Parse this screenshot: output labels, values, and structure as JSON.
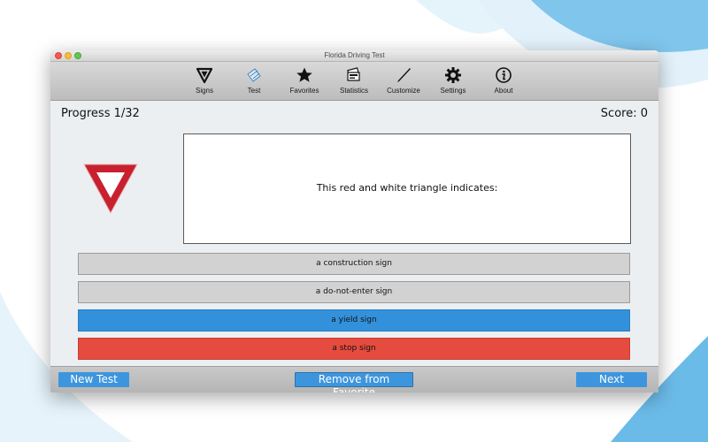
{
  "window": {
    "title": "Florida Driving Test"
  },
  "toolbar": {
    "items": [
      {
        "label": "Signs",
        "icon": "yield-sign-icon"
      },
      {
        "label": "Test",
        "icon": "pencil-paper-icon"
      },
      {
        "label": "Favorites",
        "icon": "star-icon"
      },
      {
        "label": "Statistics",
        "icon": "bank-card-icon"
      },
      {
        "label": "Customize",
        "icon": "pen-nib-icon"
      },
      {
        "label": "Settings",
        "icon": "gear-icon"
      },
      {
        "label": "About",
        "icon": "info-icon"
      }
    ]
  },
  "quiz": {
    "progress": "Progress 1/32",
    "score": "Score: 0",
    "sign_icon": "yield-sign",
    "question": "This red and white triangle indicates:",
    "answers": [
      {
        "label": "a construction sign",
        "state": "neutral"
      },
      {
        "label": "a do-not-enter sign",
        "state": "neutral"
      },
      {
        "label": "a yield sign",
        "state": "correct"
      },
      {
        "label": "a stop sign",
        "state": "incorrect"
      }
    ]
  },
  "bottom": {
    "new_test": "New Test",
    "remove_favorite": "Remove from Favorite",
    "next": "Next"
  },
  "colors": {
    "correct": "#3391dc",
    "incorrect": "#e54b3e",
    "neutral": "#d2d2d2",
    "button": "#3d96dd",
    "sign_red": "#c8202f"
  }
}
